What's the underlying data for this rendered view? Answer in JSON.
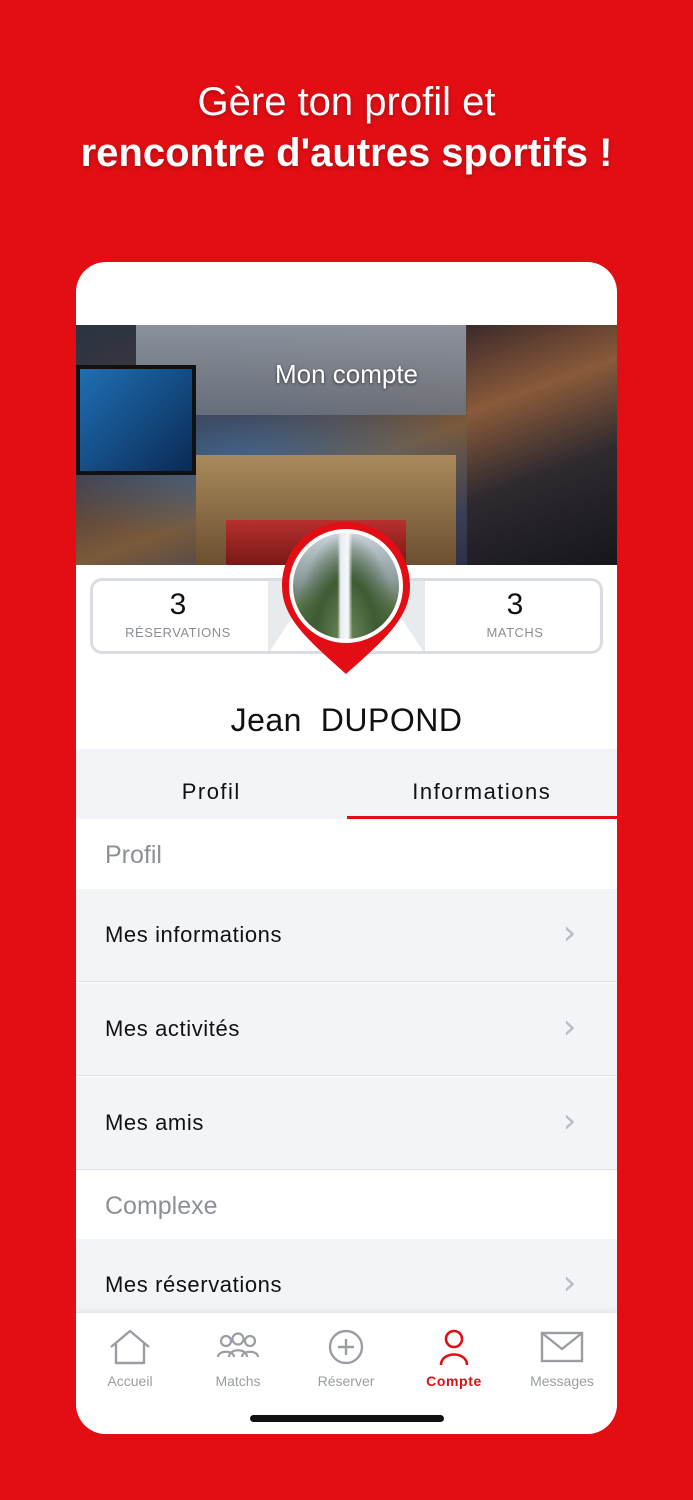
{
  "promo": {
    "line1": "Gère ton profil et",
    "line2": "rencontre d'autres sportifs !"
  },
  "header": {
    "title": "Mon compte"
  },
  "stats": {
    "reservations": {
      "value": "3",
      "label": "RÉSERVATIONS"
    },
    "matchs": {
      "value": "3",
      "label": "MATCHS"
    }
  },
  "user": {
    "first_name": "Jean",
    "last_name": "DUPOND"
  },
  "tabs": [
    {
      "label": "Profil",
      "active": false
    },
    {
      "label": "Informations",
      "active": true
    }
  ],
  "sections": {
    "profil": {
      "title": "Profil",
      "items": [
        "Mes informations",
        "Mes activités",
        "Mes amis"
      ]
    },
    "complexe": {
      "title": "Complexe",
      "items": [
        "Mes réservations"
      ]
    }
  },
  "bottom_nav": [
    {
      "label": "Accueil",
      "icon": "home-icon"
    },
    {
      "label": "Matchs",
      "icon": "group-icon"
    },
    {
      "label": "Réserver",
      "icon": "plus-circle-icon"
    },
    {
      "label": "Compte",
      "icon": "user-icon",
      "active": true
    },
    {
      "label": "Messages",
      "icon": "mail-icon"
    }
  ],
  "colors": {
    "brand": "#e20e14",
    "tabs_bg": "#f2f4f8",
    "muted": "#9a9ea4"
  }
}
